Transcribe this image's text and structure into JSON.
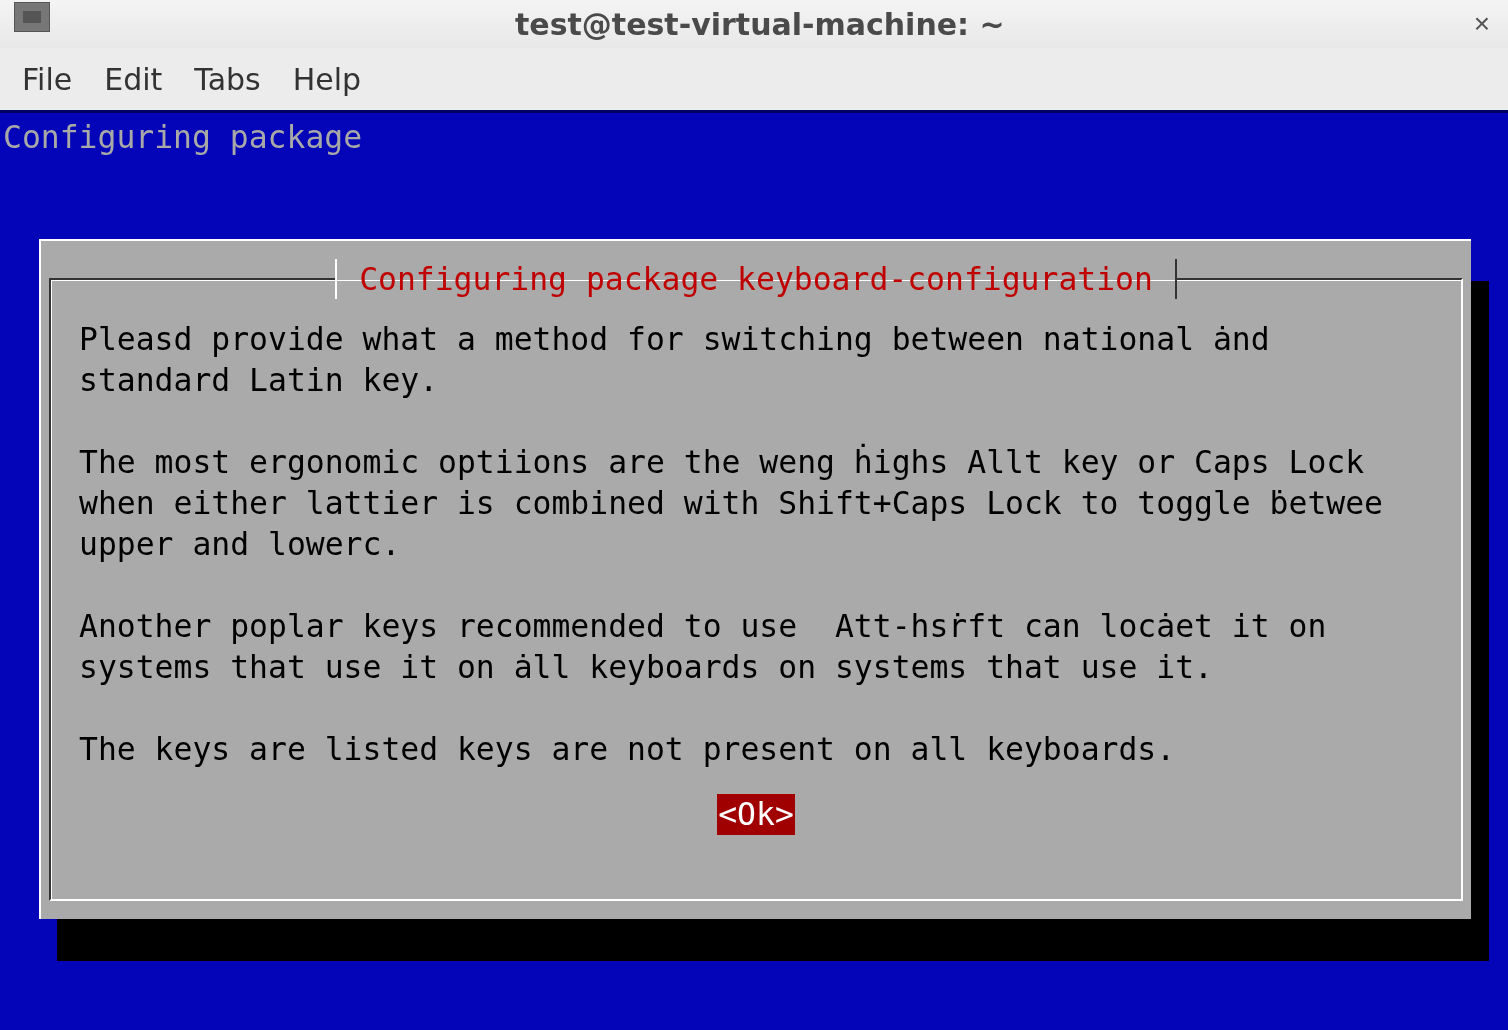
{
  "window": {
    "title": "test@test-virtual-machine: ~",
    "close": "×"
  },
  "menu": [
    "File",
    "Edit",
    "Tabs",
    "Help"
  ],
  "terminal": {
    "header": "Configuring package",
    "dialog": {
      "title": "Configuring package keyboard-configuration",
      "paragraphs": [
        "Pleasd provide what a method for switching between national ȧnd\nstandard Latin key.",
        "The most ergonomic optiions are the weng ḣighs Allt key or Caps Lock\nwhen either lattier is combined with Shift+Caps Lock to toggle ḃetwee\nupper and lowerc.",
        "Another poplar keys recommended to use  Att-hsṙft can locȧet it on\nsystems that use it on ȧll keyboards on systems that use it.",
        "The keys are listed keys are not present on all keyboards."
      ],
      "button": "<Ok>"
    }
  }
}
